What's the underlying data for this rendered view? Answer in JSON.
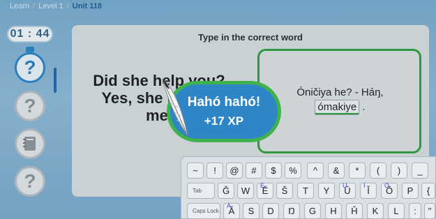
{
  "breadcrumb": {
    "items": [
      "Learn",
      "Level 1"
    ],
    "current": "Unit 118"
  },
  "timer": {
    "value": "01 : 44"
  },
  "sidebar": {
    "question_glyph": "?"
  },
  "card": {
    "instruction": "Type in the correct word",
    "prompt_lines": [
      "Did she help you?",
      "Yes, she helped",
      "me."
    ],
    "answer_prefix": "Óničiya he? - Háŋ,",
    "answer_input": "ómakiye",
    "answer_suffix": "."
  },
  "popup": {
    "title": "Hahó hahó!",
    "xp": "+17 XP"
  },
  "keyboard": {
    "row1": [
      "~",
      "!",
      "@",
      "#",
      "$",
      "%",
      "^",
      "&",
      "*",
      "(",
      ")",
      "_"
    ],
    "row2": {
      "tab": "Tab",
      "keys": [
        {
          "k": "Ǧ",
          "s": ""
        },
        {
          "k": "W",
          "s": ""
        },
        {
          "k": "Ě",
          "s": "E"
        },
        {
          "k": "Š",
          "s": ""
        },
        {
          "k": "T",
          "s": ""
        },
        {
          "k": "Y",
          "s": ""
        },
        {
          "k": "Ǔ",
          "s": "U"
        },
        {
          "k": "Ǐ",
          "s": "I"
        },
        {
          "k": "Ǒ",
          "s": "O"
        },
        {
          "k": "P",
          "s": ""
        },
        {
          "k": "{",
          "s": ""
        }
      ]
    },
    "row3": {
      "caps": "Caps Lock",
      "keys": [
        {
          "k": "Ǎ",
          "s": "A"
        },
        {
          "k": "S",
          "s": ""
        },
        {
          "k": "D",
          "s": ""
        },
        {
          "k": "Ŋ",
          "s": ""
        },
        {
          "k": "G",
          "s": ""
        },
        {
          "k": "H",
          "s": ""
        },
        {
          "k": "Ȟ",
          "s": ""
        },
        {
          "k": "K",
          "s": ""
        },
        {
          "k": "L",
          "s": ""
        },
        {
          "k": ":",
          "s": ""
        },
        {
          "k": "\"",
          "s": ""
        }
      ]
    }
  },
  "colors": {
    "accent": "#2b82c4",
    "success": "#3fb24b",
    "popup_bg": "#2e86c6"
  }
}
